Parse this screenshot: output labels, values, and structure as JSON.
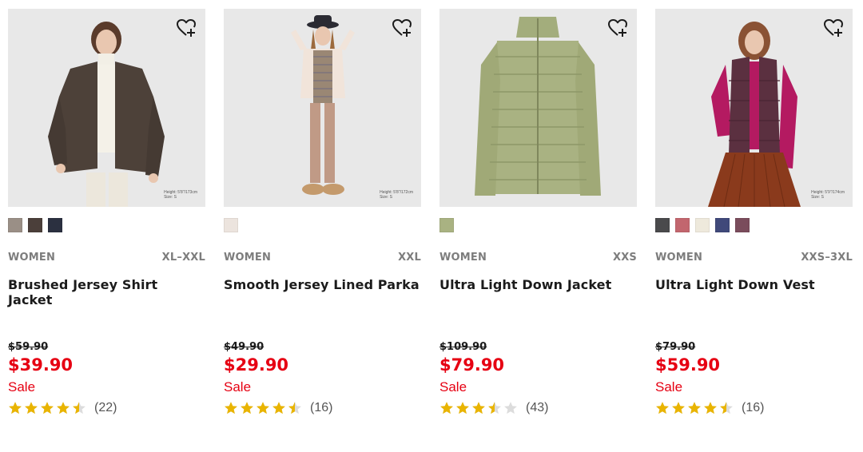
{
  "colors": {
    "sale_red": "#e60012",
    "star_gold": "#e9b400",
    "star_empty": "#dcdcdc",
    "image_bg": "#e8e8e8"
  },
  "products": [
    {
      "gender": "WOMEN",
      "sizes": "XL–XXL",
      "name": "Brushed Jersey Shirt Jacket",
      "original_price": "$59.90",
      "price": "$39.90",
      "sale_label": "Sale",
      "rating": 4.5,
      "review_count": "(22)",
      "image_caption": [
        "Height: 5'8\"/173cm",
        "Size: S"
      ],
      "swatches": [
        "#9a8f86",
        "#4b3f3a",
        "#2b3040"
      ],
      "wishlist_icon": "heart-plus-icon"
    },
    {
      "gender": "WOMEN",
      "sizes": "XXL",
      "name": "Smooth Jersey Lined Parka",
      "original_price": "$49.90",
      "price": "$29.90",
      "sale_label": "Sale",
      "rating": 4.5,
      "review_count": "(16)",
      "image_caption": [
        "Height: 5'8\"/172cm",
        "Size: S"
      ],
      "swatches": [
        "#ece4de"
      ],
      "wishlist_icon": "heart-plus-icon"
    },
    {
      "gender": "WOMEN",
      "sizes": "XXS",
      "name": "Ultra Light Down Jacket",
      "original_price": "$109.90",
      "price": "$79.90",
      "sale_label": "Sale",
      "rating": 3.5,
      "review_count": "(43)",
      "image_caption": [],
      "swatches": [
        "#a9b282"
      ],
      "wishlist_icon": "heart-plus-icon"
    },
    {
      "gender": "WOMEN",
      "sizes": "XXS–3XL",
      "name": "Ultra Light Down Vest",
      "original_price": "$79.90",
      "price": "$59.90",
      "sale_label": "Sale",
      "rating": 4.5,
      "review_count": "(16)",
      "image_caption": [
        "Height: 5'9\"/174cm",
        "Size: S"
      ],
      "swatches": [
        "#4a4a4c",
        "#c2666e",
        "#eee9dc",
        "#40497a",
        "#7a4c5c"
      ],
      "wishlist_icon": "heart-plus-icon"
    }
  ]
}
